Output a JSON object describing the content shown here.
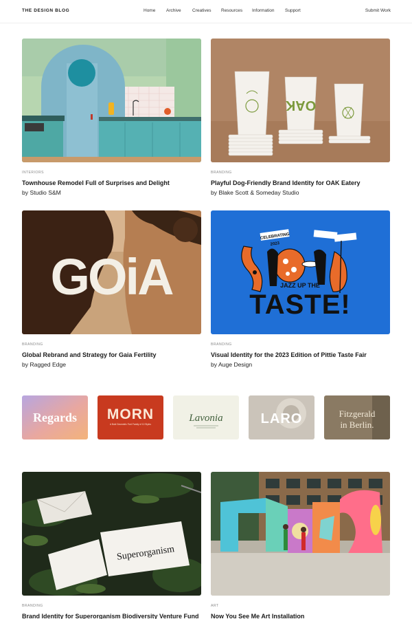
{
  "header": {
    "logo": "THE DESIGN BLOG",
    "nav": [
      "Home",
      "Archive",
      "Creatives",
      "Resources",
      "Information",
      "Support"
    ],
    "submit": "Submit Work"
  },
  "posts": [
    {
      "category": "INTERIORS",
      "title": "Townhouse Remodel Full of Surprises and Delight",
      "byline": "by Studio S&M"
    },
    {
      "category": "BRANDING",
      "title": "Playful Dog-Friendly Brand Identity for OAK Eatery",
      "byline": "by Blake Scott & Someday Studio"
    },
    {
      "category": "BRANDING",
      "title": "Global Rebrand and Strategy for Gaia Fertility",
      "byline": "by Ragged Edge"
    },
    {
      "category": "BRANDING",
      "title": "Visual Identity for the 2023 Edition of Pittie Taste Fair",
      "byline": "by Auge Design"
    },
    {
      "category": "BRANDING",
      "title": "Brand Identity for Superorganism Biodiversity Venture Fund",
      "byline": ""
    },
    {
      "category": "ART",
      "title": "Now You See Me Art Installation",
      "byline": ""
    }
  ],
  "image_text": {
    "gaia": "GOiA",
    "taste_top": "JAZZ UP THE",
    "taste_main": "TASTE!",
    "cup": "OAK",
    "card": "Superorganism",
    "celebrating": "CELEBRATING",
    "year": "2023"
  },
  "font_tiles": [
    {
      "name": "Regards"
    },
    {
      "name": "MORN",
      "caption": "A Bold Geometric Font Family of 10 Styles"
    },
    {
      "name": "Lavonia"
    },
    {
      "name": "LARO"
    },
    {
      "name": "Fitzgerald",
      "name2": "in Berlin."
    }
  ],
  "colors": {
    "accent_blue": "#1f6fd6",
    "teal": "#5fa8b0",
    "morn_red": "#c83a1f"
  }
}
